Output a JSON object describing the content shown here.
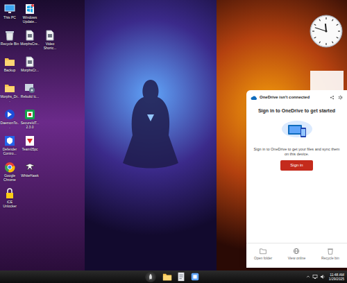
{
  "desktop": {
    "columns": [
      [
        {
          "label": "This PC",
          "kind": "pc"
        },
        {
          "label": "Recycle Bin",
          "kind": "bin"
        },
        {
          "label": "Backup",
          "kind": "folder"
        },
        {
          "label": "Morphs_Dr...",
          "kind": "folder"
        },
        {
          "label": "DaemonTo...",
          "kind": "daemon"
        },
        {
          "label": "Defender Contro...",
          "kind": "shield"
        },
        {
          "label": "Google Chrome",
          "kind": "chrome"
        },
        {
          "label": "iCE Unlocker",
          "kind": "lock"
        }
      ],
      [
        {
          "label": "Windows Update...",
          "kind": "update"
        },
        {
          "label": "MorphsCre...",
          "kind": "file"
        },
        {
          "label": "MorphsCr...",
          "kind": "file"
        },
        {
          "label": "Rebuild Ic...",
          "kind": "gear"
        },
        {
          "label": "SecureIdT... 2.3.0",
          "kind": "secure"
        },
        {
          "label": "Team05pc",
          "kind": "team"
        },
        {
          "label": "WhiteHawk",
          "kind": "hawk"
        }
      ],
      [
        {
          "label": "Video Shortc...",
          "kind": "file"
        }
      ]
    ]
  },
  "clock": {
    "hour": 11,
    "minute": 48
  },
  "onedrive": {
    "header": "OneDrive isn't connected",
    "title": "Sign in to OneDrive to get started",
    "body": "Sign in to OneDrive to get your files and sync them on this device.",
    "button": "Sign in",
    "footer": [
      {
        "label": "Open folder",
        "kind": "folder"
      },
      {
        "label": "View online",
        "kind": "globe"
      },
      {
        "label": "Recycle bin",
        "kind": "bin"
      }
    ]
  },
  "taskbar": {
    "apps": [
      {
        "kind": "explorer"
      },
      {
        "kind": "notepad"
      },
      {
        "kind": "app"
      }
    ],
    "time": "11:48 AM",
    "date": "1/29/2025"
  }
}
